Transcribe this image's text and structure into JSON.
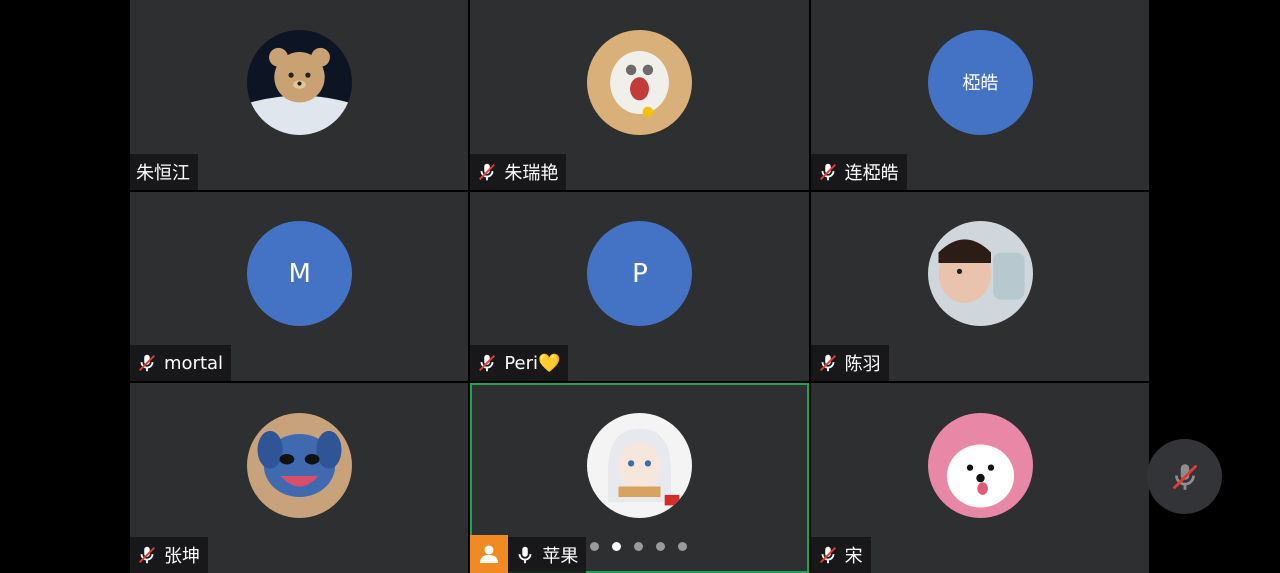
{
  "participants": [
    {
      "name": "朱恒江",
      "muted": false
    },
    {
      "name": "朱瑞艳",
      "muted": true
    },
    {
      "name": "连椏皓",
      "muted": true,
      "avatar_text": "椏皓"
    },
    {
      "name": "mortal",
      "muted": true,
      "avatar_letter": "M"
    },
    {
      "name": "Peri💛",
      "muted": true,
      "avatar_letter": "P"
    },
    {
      "name": "陈羽",
      "muted": true
    },
    {
      "name": "张坤",
      "muted": true
    },
    {
      "name": "苹果",
      "muted": false,
      "is_self": true
    },
    {
      "name": "宋",
      "muted": true
    }
  ],
  "pagination": {
    "current": 2,
    "total": 5
  },
  "colors": {
    "tile_bg": "#2e2f31",
    "avatar_blue": "#4473c5",
    "active_border": "#1fa351",
    "self_badge": "#f08a23",
    "mute_red": "#e53935"
  },
  "icons": {
    "muted": "mic-muted-icon",
    "mic": "mic-icon",
    "self": "person-icon"
  }
}
